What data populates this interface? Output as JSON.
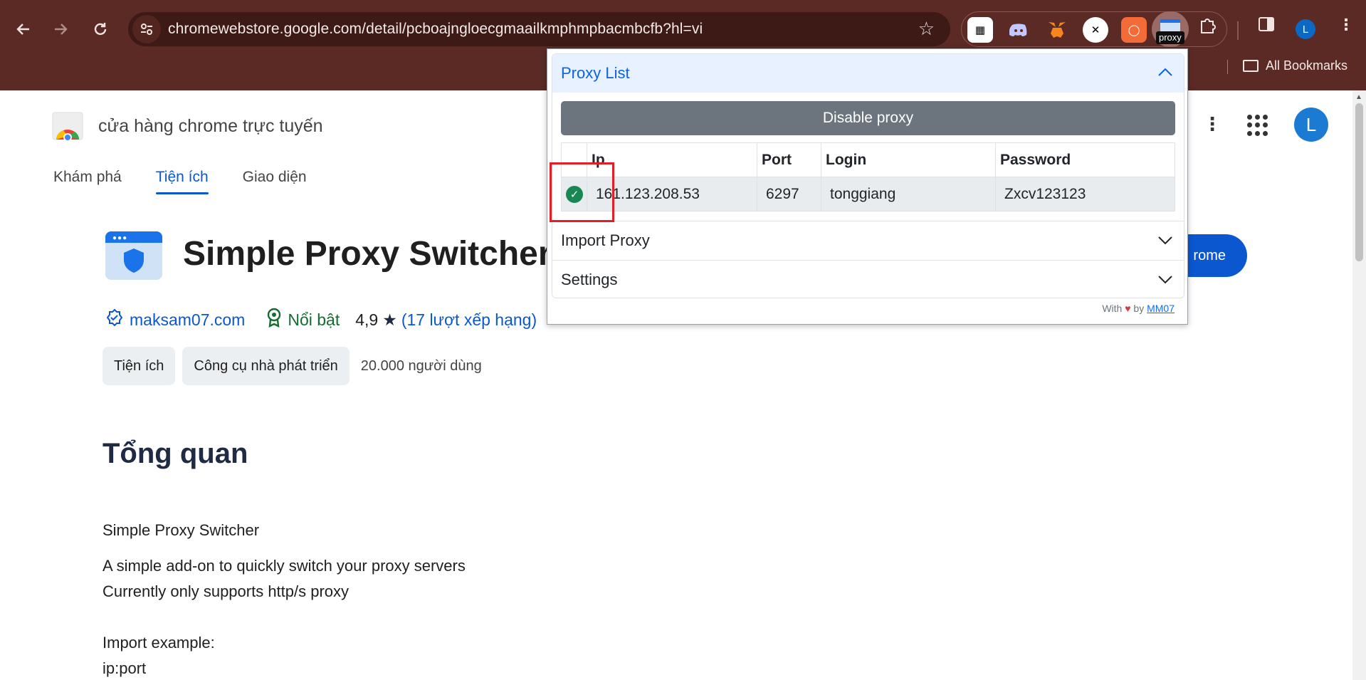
{
  "browser": {
    "url": "chromewebstore.google.com/detail/pcboajngloecgmaailkmphmpbacmbcfb?hl=vi",
    "proxy_badge": "proxy",
    "profile_initial": "L",
    "bookmarks_label": "All Bookmarks"
  },
  "store": {
    "title": "cửa hàng chrome trực tuyến",
    "profile_initial": "L",
    "tabs": [
      {
        "label": "Khám phá"
      },
      {
        "label": "Tiện ích"
      },
      {
        "label": "Giao diện"
      }
    ]
  },
  "extension": {
    "name": "Simple Proxy Switcher",
    "install_label": "rome",
    "site": "maksam07.com",
    "featured": "Nổi bật",
    "rating": "4,9",
    "ratings_link": "(17 lượt xếp hạng)",
    "chips": [
      "Tiện ích",
      "Công cụ nhà phát triển"
    ],
    "users": "20.000 người dùng",
    "overview_heading": "Tổng quan",
    "desc_lines": [
      "Simple Proxy Switcher",
      "A simple add-on to quickly switch your proxy servers",
      "Currently only supports http/s proxy",
      "Import example:",
      "ip:port"
    ]
  },
  "popup": {
    "proxy_list_label": "Proxy List",
    "disable_button": "Disable proxy",
    "columns": [
      "Ip",
      "Port",
      "Login",
      "Password"
    ],
    "rows": [
      {
        "active": true,
        "ip": "161.123.208.53",
        "port": "6297",
        "login": "tonggiang",
        "password": "Zxcv123123"
      }
    ],
    "import_label": "Import Proxy",
    "settings_label": "Settings",
    "footer_with": "With",
    "footer_by": "by",
    "footer_link": "MM07"
  }
}
